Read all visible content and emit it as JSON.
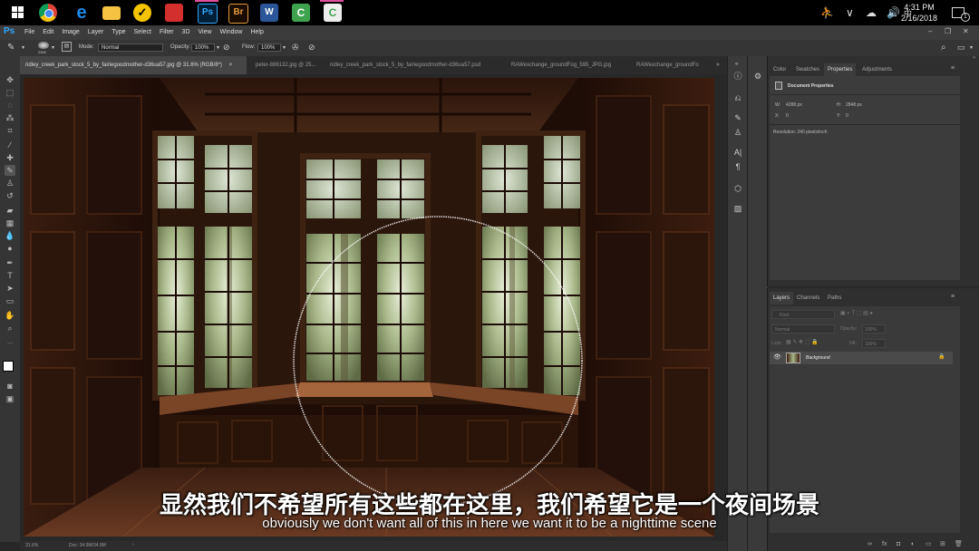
{
  "taskbar": {
    "apps": [
      {
        "name": "windows-start",
        "color": "#ffffff"
      },
      {
        "name": "chrome",
        "color": "#e7b416"
      },
      {
        "name": "edge",
        "color": "#1e88e5"
      },
      {
        "name": "file-explorer",
        "color": "#f6c343"
      },
      {
        "name": "norton",
        "color": "#f5c400"
      },
      {
        "name": "red-app",
        "color": "#d32f2f"
      },
      {
        "name": "photoshop",
        "color": "#31a8ff"
      },
      {
        "name": "bridge",
        "color": "#8b5a14"
      },
      {
        "name": "word",
        "color": "#2b579a"
      },
      {
        "name": "camtasia",
        "color": "#3fa34d"
      },
      {
        "name": "camtasia-recorder",
        "color": "#eeeeee"
      }
    ],
    "time": "4:31 PM",
    "date": "2/16/2018",
    "notifications": "1"
  },
  "menubar": {
    "logo": "Ps",
    "items": [
      "File",
      "Edit",
      "Image",
      "Layer",
      "Type",
      "Select",
      "Filter",
      "3D",
      "View",
      "Window",
      "Help"
    ]
  },
  "options": {
    "brush_size": "2300",
    "mode_label": "Mode:",
    "mode_value": "Normal",
    "opacity_label": "Opacity:",
    "opacity_value": "100%",
    "flow_label": "Flow:",
    "flow_value": "100%"
  },
  "tabs": [
    {
      "label": "ridley_creek_park_stock_5_by_fairiegoodmother-d36ua57.jpg @ 31.6% (RGB/8*)",
      "active": true
    },
    {
      "label": "peter-886132.jpg @ 25...",
      "active": false
    },
    {
      "label": "ridley_creek_park_stock_5_by_fairiegoodmother-d36ua57.psd",
      "active": false
    },
    {
      "label": "RAWexchange_groundFog_595_JPG.jpg",
      "active": false
    },
    {
      "label": "RAWexchange_groundFo",
      "active": false
    }
  ],
  "status": {
    "zoom": "31.6%",
    "doc": "Doc: 34.9M/34.9M"
  },
  "properties": {
    "tabs": [
      "Color",
      "Swatches",
      "Properties",
      "Adjustments"
    ],
    "active_tab": "Properties",
    "title": "Document Properties",
    "w_label": "W:",
    "w_value": "4288 px",
    "h_label": "H:",
    "h_value": "2848 px",
    "x_label": "X:",
    "x_value": "0",
    "y_label": "Y:",
    "y_value": "0",
    "resolution": "Resolution: 240 pixels/inch"
  },
  "layers": {
    "tabs": [
      "Layers",
      "Channels",
      "Paths"
    ],
    "active_tab": "Layers",
    "kind_placeholder": "Kind",
    "blend_mode": "Normal",
    "opacity_label": "Opacity:",
    "opacity_value": "100%",
    "lock_label": "Lock:",
    "fill_label": "Fill:",
    "fill_value": "100%",
    "layer_name": "Background"
  },
  "subtitles": {
    "chinese": "显然我们不希望所有这些都在这里，我们希望它是一个夜间场景",
    "english": "obviously we don't want all of this in here we want it to be a nighttime scene"
  }
}
